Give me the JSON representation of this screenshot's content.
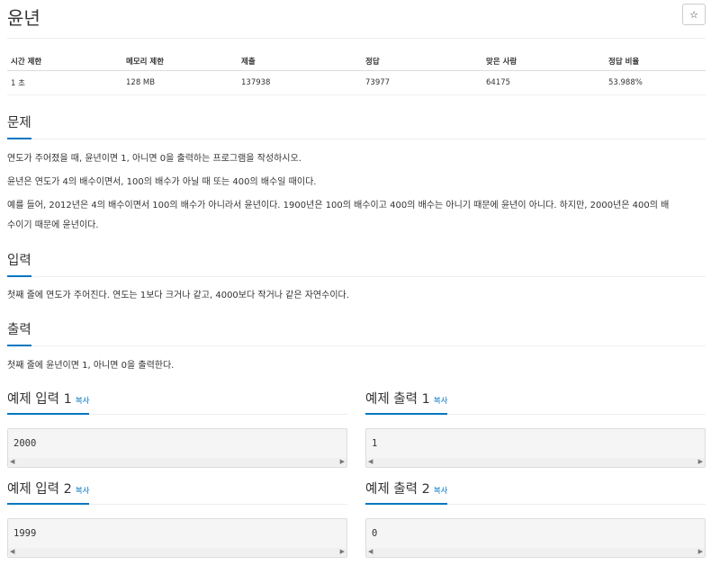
{
  "problem": {
    "title": "윤년",
    "star_icon": "☆"
  },
  "stats": {
    "headers": [
      "시간 제한",
      "메모리 제한",
      "제출",
      "정답",
      "맞은 사람",
      "정답 비율"
    ],
    "values": [
      "1 초",
      "128 MB",
      "137938",
      "73977",
      "64175",
      "53.988%"
    ]
  },
  "sections": {
    "description": {
      "heading": "문제",
      "p1": "연도가 주어졌을 때, 윤년이면 1, 아니면 0을 출력하는 프로그램을 작성하시오.",
      "p2": "윤년은 연도가 4의 배수이면서, 100의 배수가 아닐 때 또는 400의 배수일 때이다.",
      "p3a": "예를 들어, 2012년은 4의 배수이면서 100의 배수가 아니라서 윤년이다. 1900년은 100의 배수이고 400의 배수는 아니기 때문에 윤년이 아니다. 하지만, 2000년은 400의 배",
      "p3b": "수이기 때문에 윤년이다."
    },
    "input": {
      "heading": "입력",
      "text": "첫째 줄에 연도가 주어진다. 연도는 1보다 크거나 같고, 4000보다 작거나 같은 자연수이다."
    },
    "output": {
      "heading": "출력",
      "text": "첫째 줄에 윤년이면 1, 아니면 0을 출력한다."
    }
  },
  "samples": {
    "copy_label": "복사",
    "in1_title": "예제 입력 1",
    "out1_title": "예제 출력 1",
    "in2_title": "예제 입력 2",
    "out2_title": "예제 출력 2",
    "in1": "2000",
    "out1": "1",
    "in2": "1999",
    "out2": "0"
  },
  "colors": {
    "accent": "#0076c0",
    "sample_bg": "#f5f5f5"
  }
}
